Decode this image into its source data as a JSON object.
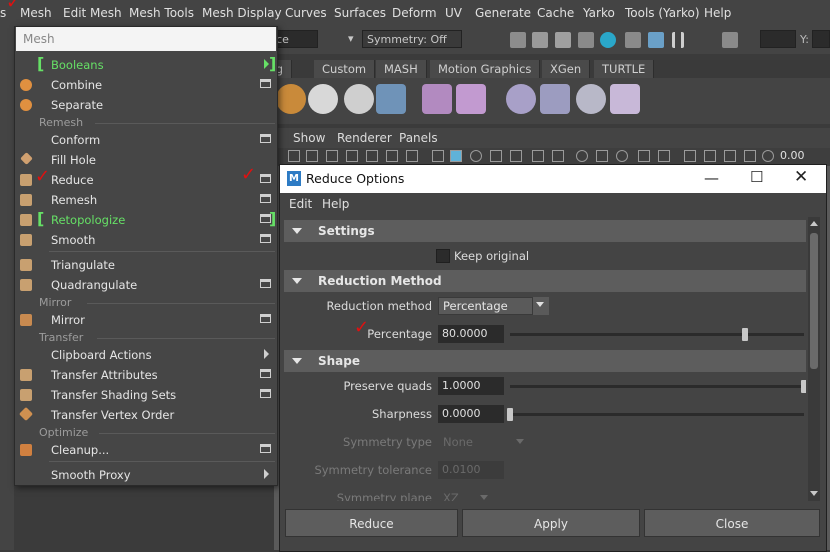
{
  "menubar": {
    "items": [
      "s",
      "Mesh",
      "Edit Mesh",
      "Mesh Tools",
      "Mesh Display",
      "Curves",
      "Surfaces",
      "Deform",
      "UV",
      "Generate",
      "Cache",
      "Yarko",
      "Tools (Yarko)",
      "Help"
    ]
  },
  "statusline": {
    "surface_field": "rface",
    "symmetry": "Symmetry: Off",
    "x_label": "X:",
    "y_label": "Y:"
  },
  "shelf": {
    "tabs": [
      "ning",
      "Custom",
      "MASH",
      "Motion Graphics",
      "XGen",
      "TURTLE"
    ],
    "left_label": "ggi"
  },
  "viewport_menu": {
    "items": [
      "Show",
      "Renderer",
      "Panels"
    ],
    "value": "0.00"
  },
  "menu": {
    "search_placeholder": "Mesh",
    "items": [
      {
        "label": "Booleans",
        "highlight": true,
        "submenu": true
      },
      {
        "label": "Combine",
        "option_box": true
      },
      {
        "label": "Separate"
      },
      {
        "section": "Remesh"
      },
      {
        "label": "Conform",
        "option_box": true
      },
      {
        "label": "Fill Hole"
      },
      {
        "label": "Reduce",
        "option_box": true,
        "checked": true
      },
      {
        "label": "Remesh",
        "option_box": true
      },
      {
        "label": "Retopologize",
        "highlight": true,
        "option_box": true
      },
      {
        "label": "Smooth",
        "option_box": true
      },
      {
        "label": "Triangulate"
      },
      {
        "label": "Quadrangulate",
        "option_box": true
      },
      {
        "section": "Mirror"
      },
      {
        "label": "Mirror",
        "option_box": true
      },
      {
        "section": "Transfer"
      },
      {
        "label": "Clipboard Actions",
        "submenu": true
      },
      {
        "label": "Transfer Attributes",
        "option_box": true
      },
      {
        "label": "Transfer Shading Sets",
        "option_box": true
      },
      {
        "label": "Transfer Vertex Order"
      },
      {
        "section": "Optimize"
      },
      {
        "label": "Cleanup...",
        "option_box": true
      },
      {
        "label": "Smooth Proxy",
        "submenu": true
      }
    ]
  },
  "dialog": {
    "title": "Reduce Options",
    "menu": [
      "Edit",
      "Help"
    ],
    "settings": {
      "header": "Settings",
      "keep_original": "Keep original"
    },
    "reduction": {
      "header": "Reduction Method",
      "method_label": "Reduction method",
      "method_value": "Percentage",
      "percentage_label": "Percentage",
      "percentage_value": "80.0000",
      "percentage_fraction": 0.8
    },
    "shape": {
      "header": "Shape",
      "preserve_quads_label": "Preserve quads",
      "preserve_quads_value": "1.0000",
      "preserve_quads_fraction": 1.0,
      "sharpness_label": "Sharpness",
      "sharpness_value": "0.0000",
      "sharpness_fraction": 0.0,
      "symmetry_type_label": "Symmetry type",
      "symmetry_type_value": "None",
      "symmetry_tolerance_label": "Symmetry tolerance",
      "symmetry_tolerance_value": "0.0100",
      "symmetry_plane_label": "Symmetry plane",
      "symmetry_plane_value": "XZ"
    },
    "buttons": {
      "reduce": "Reduce",
      "apply": "Apply",
      "close": "Close"
    }
  },
  "colors": {
    "highlight_green": "#66e066",
    "check_red": "#e01010",
    "panel": "#444444",
    "section_header": "#5d5d5d"
  }
}
